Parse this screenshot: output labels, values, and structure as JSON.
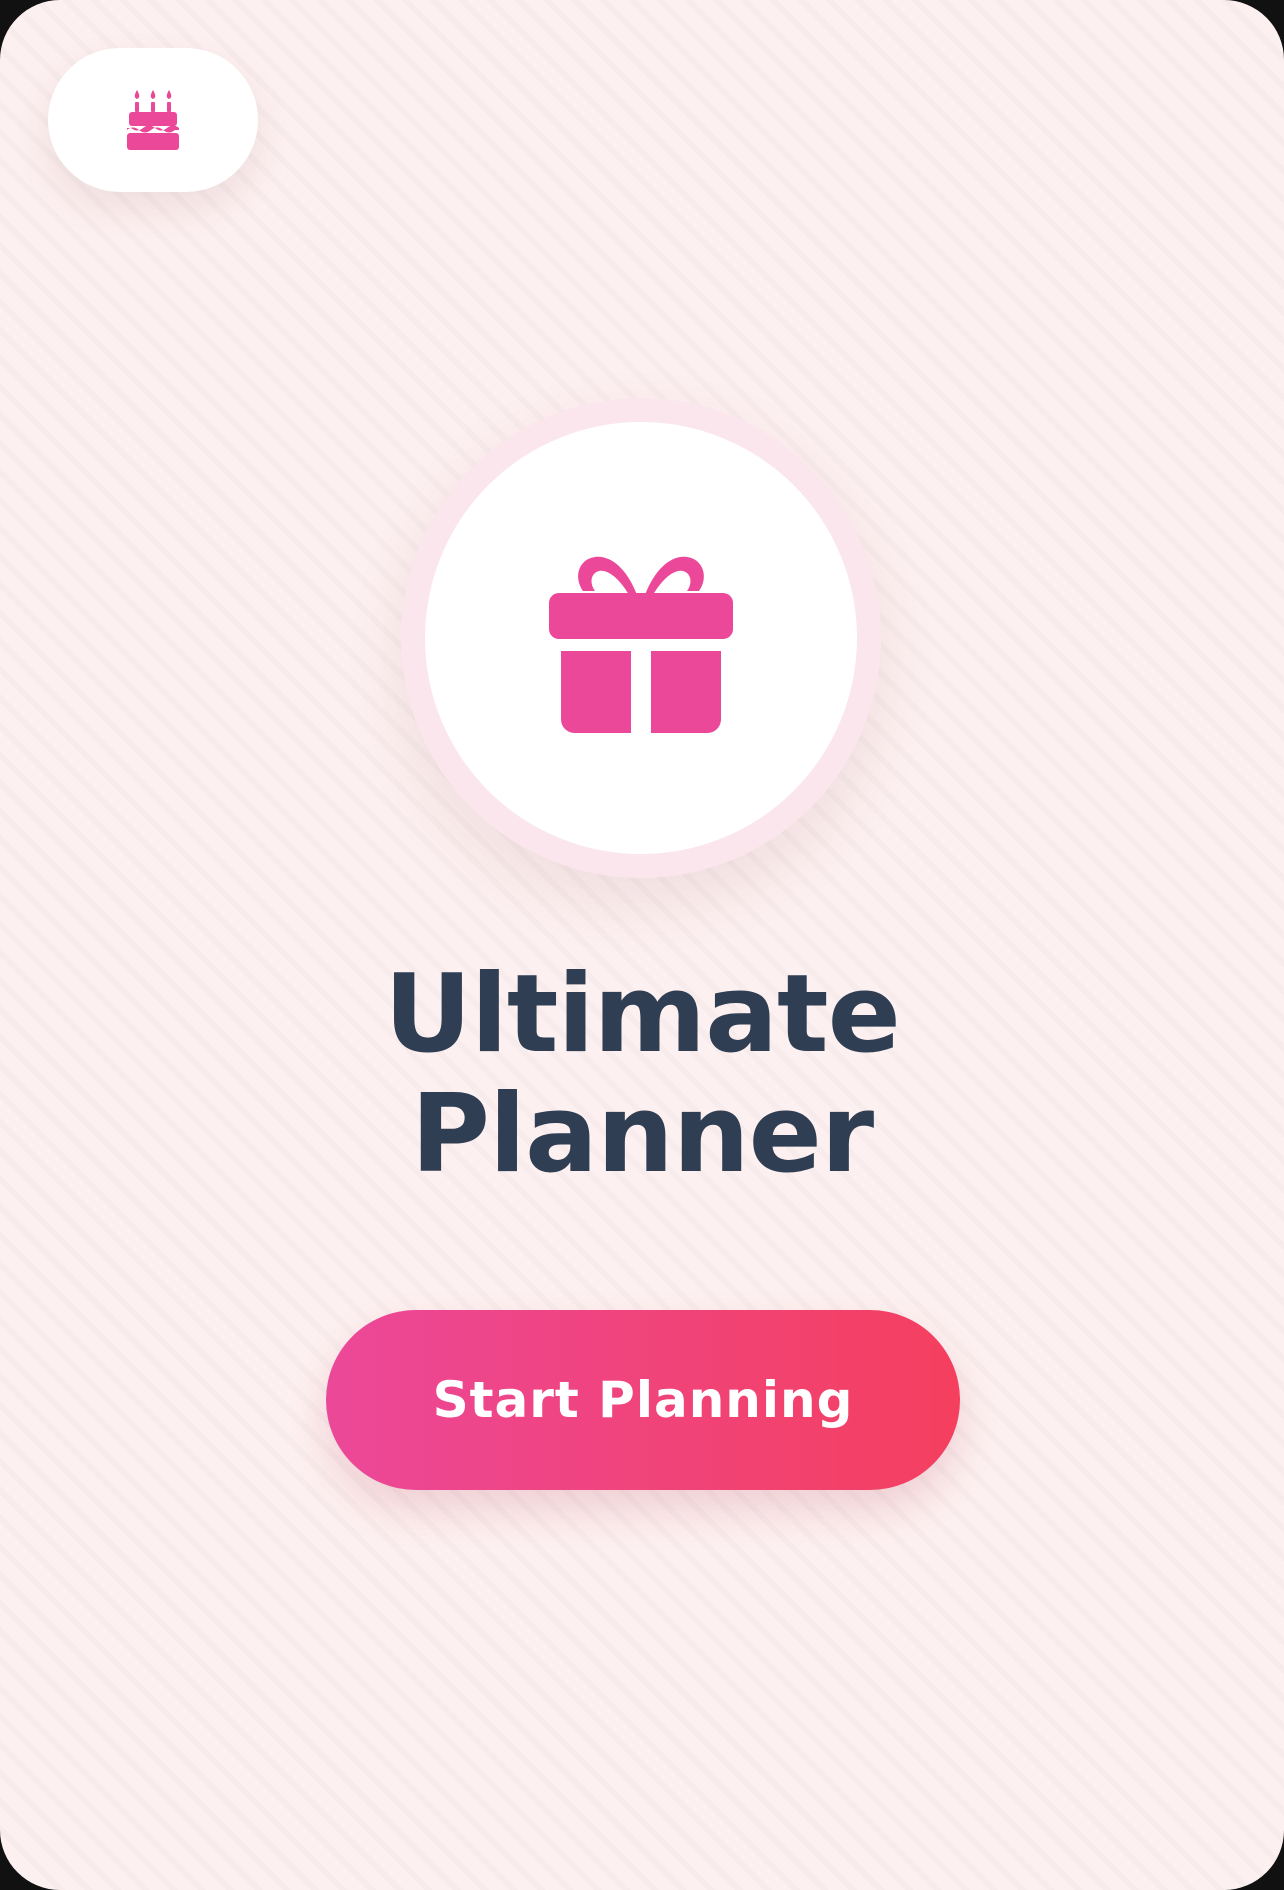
{
  "header": {
    "icon": "birthday-cake-icon"
  },
  "hero": {
    "icon": "gift-icon"
  },
  "title": {
    "line1": "Ultimate",
    "line2": "Planner"
  },
  "cta": {
    "label": "Start Planning"
  },
  "colors": {
    "accent_pink": "#ec4899",
    "accent_rose": "#f43f5e",
    "title_text": "#2f3e52",
    "background": "#fdf0f0",
    "ring": "#fbe6ee"
  }
}
